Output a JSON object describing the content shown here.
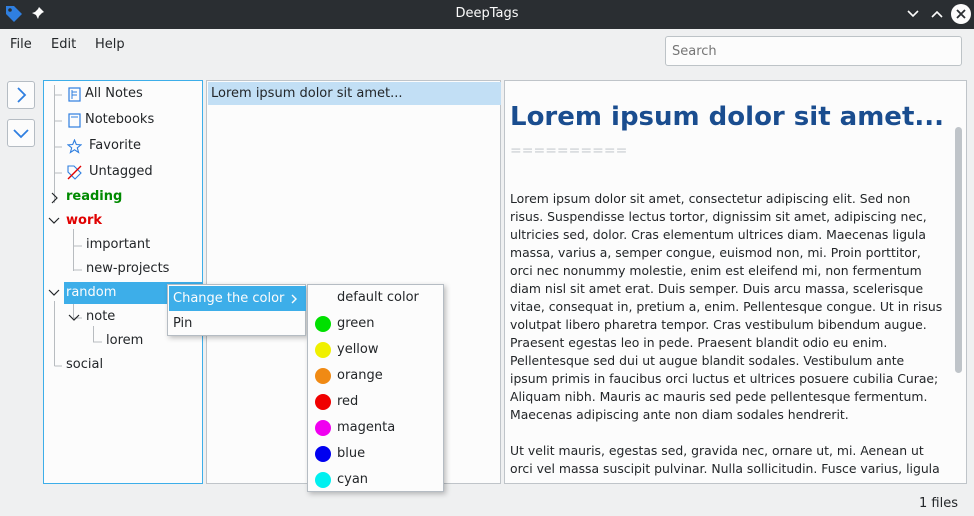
{
  "window": {
    "title": "DeepTags"
  },
  "menubar": {
    "file": "File",
    "edit": "Edit",
    "help": "Help"
  },
  "search": {
    "placeholder": "Search",
    "value": ""
  },
  "tree": {
    "all_notes": "All Notes",
    "notebooks": "Notebooks",
    "favorite": "Favorite",
    "untagged": "Untagged",
    "reading": "reading",
    "work": "work",
    "important": "important",
    "new_projects": "new-projects",
    "random": "random",
    "note": "note",
    "lorem": "lorem",
    "social": "social"
  },
  "tag_colors": {
    "reading": "#008a00",
    "work": "#e00000",
    "selected_bg": "#3daee9"
  },
  "notes_list": [
    "Lorem ipsum dolor sit amet..."
  ],
  "viewer": {
    "title": "Lorem ipsum dolor sit amet...",
    "rule": "==========",
    "para1": "Lorem ipsum dolor sit amet, consectetur adipiscing elit. Sed non risus. Suspendisse lectus tortor, dignissim sit amet, adipiscing nec, ultricies sed, dolor. Cras elementum ultrices diam. Maecenas ligula massa, varius a, semper congue, euismod non, mi. Proin porttitor, orci nec nonummy molestie, enim est eleifend mi, non fermentum diam nisl sit amet erat. Duis semper. Duis arcu massa, scelerisque vitae, consequat in, pretium a, enim. Pellentesque congue. Ut in risus volutpat libero pharetra tempor. Cras vestibulum bibendum augue. Praesent egestas leo in pede. Praesent blandit odio eu enim. Pellentesque sed dui ut augue blandit sodales. Vestibulum ante ipsum primis in faucibus orci luctus et ultrices posuere cubilia Curae; Aliquam nibh. Mauris ac mauris sed pede pellentesque fermentum. Maecenas adipiscing ante non diam sodales hendrerit.",
    "para2": "Ut velit mauris, egestas sed, gravida nec, ornare ut, mi. Aenean ut orci vel massa suscipit pulvinar. Nulla sollicitudin. Fusce varius, ligula non"
  },
  "context_menu": {
    "change_color": "Change the color",
    "pin": "Pin"
  },
  "color_menu": [
    {
      "label": "default color",
      "color": ""
    },
    {
      "label": "green",
      "color": "#00e000"
    },
    {
      "label": "yellow",
      "color": "#f0f000"
    },
    {
      "label": "orange",
      "color": "#f08a14"
    },
    {
      "label": "red",
      "color": "#f00000"
    },
    {
      "label": "magenta",
      "color": "#f000f0"
    },
    {
      "label": "blue",
      "color": "#0000f0"
    },
    {
      "label": "cyan",
      "color": "#00f0f0"
    }
  ],
  "status": {
    "files": "1 files"
  }
}
